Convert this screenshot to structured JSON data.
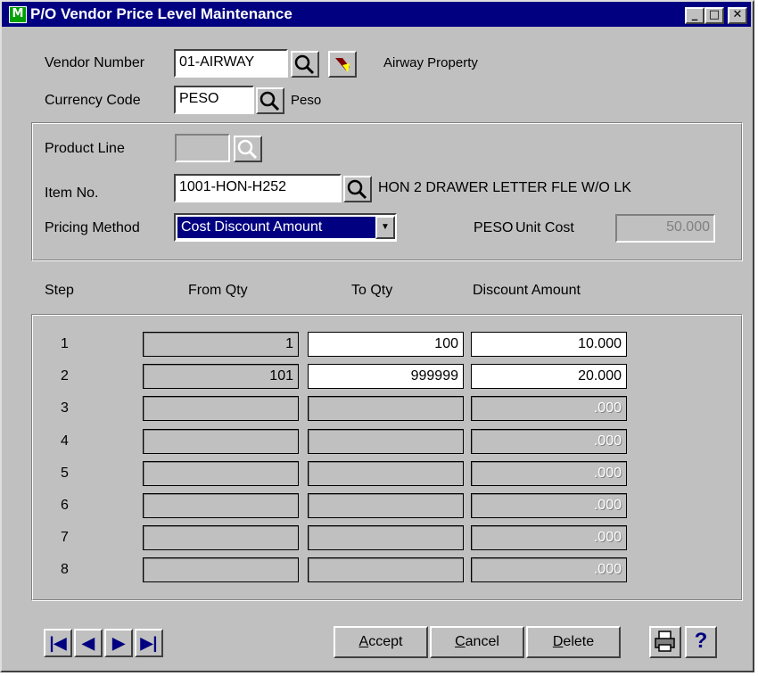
{
  "window": {
    "title": "P/O Vendor Price Level Maintenance",
    "icon": "app-m-icon",
    "controls": {
      "minimize": "_",
      "maximize": "□",
      "close": "✕"
    }
  },
  "vendor": {
    "label": "Vendor Number",
    "value": "01-AIRWAY",
    "name": "Airway Property"
  },
  "currency": {
    "label": "Currency Code",
    "value": "PESO",
    "name": "Peso"
  },
  "product_line": {
    "label": "Product Line",
    "value": ""
  },
  "item": {
    "label": "Item No.",
    "value": "1001-HON-H252",
    "description": "HON 2 DRAWER LETTER FLE W/O LK"
  },
  "pricing": {
    "label": "Pricing Method",
    "value": "Cost Discount Amount",
    "currency": "PESO",
    "unit_cost_label": "Unit Cost",
    "unit_cost": "50.000"
  },
  "grid": {
    "headers": {
      "step": "Step",
      "from": "From Qty",
      "to": "To Qty",
      "amount": "Discount Amount"
    },
    "rows": [
      {
        "step": "1",
        "from": "1",
        "to": "100",
        "amount": "10.000"
      },
      {
        "step": "2",
        "from": "101",
        "to": "999999",
        "amount": "20.000"
      },
      {
        "step": "3",
        "from": "",
        "to": "",
        "amount": ".000"
      },
      {
        "step": "4",
        "from": "",
        "to": "",
        "amount": ".000"
      },
      {
        "step": "5",
        "from": "",
        "to": "",
        "amount": ".000"
      },
      {
        "step": "6",
        "from": "",
        "to": "",
        "amount": ".000"
      },
      {
        "step": "7",
        "from": "",
        "to": "",
        "amount": ".000"
      },
      {
        "step": "8",
        "from": "",
        "to": "",
        "amount": ".000"
      }
    ]
  },
  "nav": {
    "first": "first-record-icon",
    "prev": "previous-record-icon",
    "next": "next-record-icon",
    "last": "last-record-icon"
  },
  "buttons": {
    "accept": {
      "key": "A",
      "rest": "ccept"
    },
    "cancel": {
      "key": "C",
      "rest": "ancel"
    },
    "delete": {
      "key": "D",
      "rest": "elete"
    }
  },
  "colors": {
    "title_bar": "#000080",
    "face": "#c0c0c0",
    "selection": "#000080"
  }
}
